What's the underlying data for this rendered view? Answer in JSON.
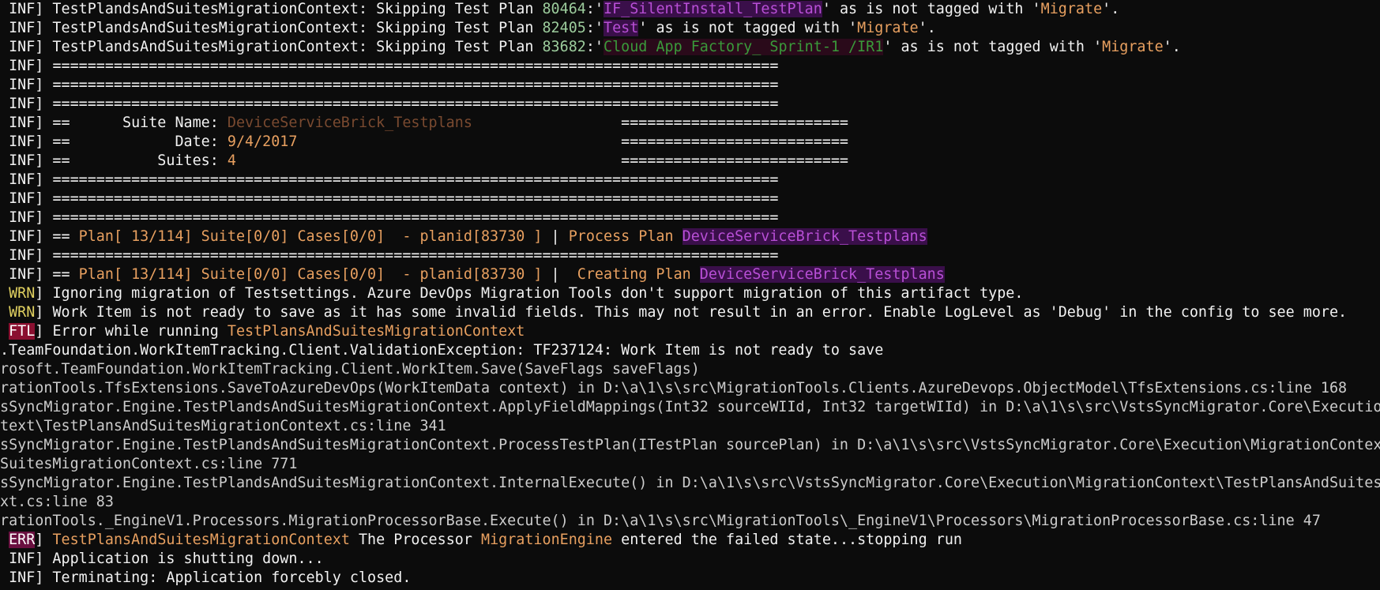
{
  "terminal": {
    "lines": [
      [
        {
          "t": " INF] TestPlandsAndSuitesMigrationContext: Skipping Test Plan ",
          "c": "c-white"
        },
        {
          "t": "80464",
          "c": "c-number"
        },
        {
          "t": ":'",
          "c": "c-white"
        },
        {
          "t": "IF_SilentInstall_TestPlan",
          "c": "c-highlight-purple"
        },
        {
          "t": "' as is not tagged with '",
          "c": "c-white"
        },
        {
          "t": "Migrate",
          "c": "c-orange"
        },
        {
          "t": "'.",
          "c": "c-white"
        }
      ],
      [
        {
          "t": " INF] TestPlandsAndSuitesMigrationContext: Skipping Test Plan ",
          "c": "c-white"
        },
        {
          "t": "82405",
          "c": "c-number"
        },
        {
          "t": ":'",
          "c": "c-white"
        },
        {
          "t": "Test",
          "c": "c-highlight-purple"
        },
        {
          "t": "' as is not tagged with '",
          "c": "c-white"
        },
        {
          "t": "Migrate",
          "c": "c-orange"
        },
        {
          "t": "'.",
          "c": "c-white"
        }
      ],
      [
        {
          "t": " INF] TestPlandsAndSuitesMigrationContext: Skipping Test Plan ",
          "c": "c-white"
        },
        {
          "t": "83682",
          "c": "c-number"
        },
        {
          "t": ":'",
          "c": "c-white"
        },
        {
          "t": "Cloud App Factory_ Sprint-1 /IR1",
          "c": "c-darkred-green"
        },
        {
          "t": "' as is not tagged with '",
          "c": "c-white"
        },
        {
          "t": "Migrate",
          "c": "c-orange"
        },
        {
          "t": "'.",
          "c": "c-white"
        }
      ],
      [
        {
          "t": " INF] ",
          "c": "c-white"
        },
        {
          "t": "===================================================================================",
          "c": "c-white"
        }
      ],
      [
        {
          "t": " INF] ",
          "c": "c-white"
        },
        {
          "t": "===================================================================================",
          "c": "c-white"
        }
      ],
      [
        {
          "t": " INF] ",
          "c": "c-white"
        },
        {
          "t": "===================================================================================",
          "c": "c-white"
        }
      ],
      [
        {
          "t": " INF] ==      Suite Name: ",
          "c": "c-white"
        },
        {
          "t": "DeviceServiceBrick_Testplans",
          "c": "c-dimorange"
        },
        {
          "t": "                 ==========================",
          "c": "c-white"
        }
      ],
      [
        {
          "t": " INF] ==            Date: ",
          "c": "c-white"
        },
        {
          "t": "9/4/2017",
          "c": "c-orange"
        },
        {
          "t": "                                     ==========================",
          "c": "c-white"
        }
      ],
      [
        {
          "t": " INF] ==          Suites: ",
          "c": "c-white"
        },
        {
          "t": "4",
          "c": "c-orange"
        },
        {
          "t": "                                            ==========================",
          "c": "c-white"
        }
      ],
      [
        {
          "t": " INF] ",
          "c": "c-white"
        },
        {
          "t": "===================================================================================",
          "c": "c-white"
        }
      ],
      [
        {
          "t": " INF] ",
          "c": "c-white"
        },
        {
          "t": "===================================================================================",
          "c": "c-white"
        }
      ],
      [
        {
          "t": " INF] ",
          "c": "c-white"
        },
        {
          "t": "===================================================================================",
          "c": "c-white"
        }
      ],
      [
        {
          "t": " INF] == ",
          "c": "c-white"
        },
        {
          "t": "Plan[ 13/114] Suite[0/0] Cases[0/0]  - planid[83730 ]",
          "c": "c-orange"
        },
        {
          "t": " | ",
          "c": "c-white"
        },
        {
          "t": "Process Plan ",
          "c": "c-orange"
        },
        {
          "t": "DeviceServiceBrick_Testplans",
          "c": "c-highlight-purple"
        }
      ],
      [
        {
          "t": " INF] ",
          "c": "c-white"
        },
        {
          "t": "===================================================================================",
          "c": "c-white"
        }
      ],
      [
        {
          "t": " INF] == ",
          "c": "c-white"
        },
        {
          "t": "Plan[ 13/114] Suite[0/0] Cases[0/0]  - planid[83730 ]",
          "c": "c-orange"
        },
        {
          "t": " |  ",
          "c": "c-white"
        },
        {
          "t": "Creating Plan ",
          "c": "c-orange"
        },
        {
          "t": "DeviceServiceBrick_Testplans",
          "c": "c-highlight-purple"
        }
      ],
      [
        {
          "t": " WRN",
          "c": "c-yellow"
        },
        {
          "t": "] Ignoring migration of Testsettings. Azure DevOps Migration Tools don't support migration of this artifact type.",
          "c": "c-white"
        }
      ],
      [
        {
          "t": " WRN",
          "c": "c-yellow"
        },
        {
          "t": "] Work Item is not ready to save as it has some invalid fields. This may not result in an error. Enable LogLevel as 'Debug' in the config to see more.",
          "c": "c-white"
        }
      ],
      [
        {
          "t": " ",
          "c": "c-white"
        },
        {
          "t": "FTL",
          "c": "c-ftl"
        },
        {
          "t": "] Error while running ",
          "c": "c-white"
        },
        {
          "t": "TestPlansAndSuitesMigrationContext",
          "c": "c-orange"
        }
      ],
      [
        {
          "t": ".TeamFoundation.WorkItemTracking.Client.ValidationException: TF237124: Work Item is not ready to save",
          "c": "c-white"
        }
      ],
      [
        {
          "t": "rosoft.TeamFoundation.WorkItemTracking.Client.WorkItem.Save(SaveFlags saveFlags)",
          "c": "c-default"
        }
      ],
      [
        {
          "t": "rationTools.TfsExtensions.SaveToAzureDevOps(WorkItemData context) in D:\\a\\1\\s\\src\\MigrationTools.Clients.AzureDevops.ObjectModel\\TfsExtensions.cs:line 168",
          "c": "c-default"
        }
      ],
      [
        {
          "t": "sSyncMigrator.Engine.TestPlandsAndSuitesMigrationContext.ApplyFieldMappings(Int32 sourceWIId, Int32 targetWIId) in D:\\a\\1\\s\\src\\VstsSyncMigrator.Core\\Execution\\M",
          "c": "c-default"
        }
      ],
      [
        {
          "t": "text\\TestPlansAndSuitesMigrationContext.cs:line 341",
          "c": "c-default"
        }
      ],
      [
        {
          "t": "sSyncMigrator.Engine.TestPlandsAndSuitesMigrationContext.ProcessTestPlan(ITestPlan sourcePlan) in D:\\a\\1\\s\\src\\VstsSyncMigrator.Core\\Execution\\MigrationContext\\",
          "c": "c-default"
        }
      ],
      [
        {
          "t": "SuitesMigrationContext.cs:line 771",
          "c": "c-default"
        }
      ],
      [
        {
          "t": "sSyncMigrator.Engine.TestPlandsAndSuitesMigrationContext.InternalExecute() in D:\\a\\1\\s\\src\\VstsSyncMigrator.Core\\Execution\\MigrationContext\\TestPlansAndSuitesM",
          "c": "c-default"
        }
      ],
      [
        {
          "t": "xt.cs:line 83",
          "c": "c-default"
        }
      ],
      [
        {
          "t": "rationTools._EngineV1.Processors.MigrationProcessorBase.Execute() in D:\\a\\1\\s\\src\\MigrationTools\\_EngineV1\\Processors\\MigrationProcessorBase.cs:line 47",
          "c": "c-default"
        }
      ],
      [
        {
          "t": " ",
          "c": "c-white"
        },
        {
          "t": "ERR",
          "c": "c-err"
        },
        {
          "t": "] ",
          "c": "c-white"
        },
        {
          "t": "TestPlansAndSuitesMigrationContext",
          "c": "c-orange"
        },
        {
          "t": " The Processor ",
          "c": "c-white"
        },
        {
          "t": "MigrationEngine",
          "c": "c-orange"
        },
        {
          "t": " entered the failed state...stopping run",
          "c": "c-white"
        }
      ],
      [
        {
          "t": " INF] Application is shutting down...",
          "c": "c-white"
        }
      ],
      [
        {
          "t": " INF] Terminating: Application forcebly closed.",
          "c": "c-white"
        }
      ]
    ]
  }
}
